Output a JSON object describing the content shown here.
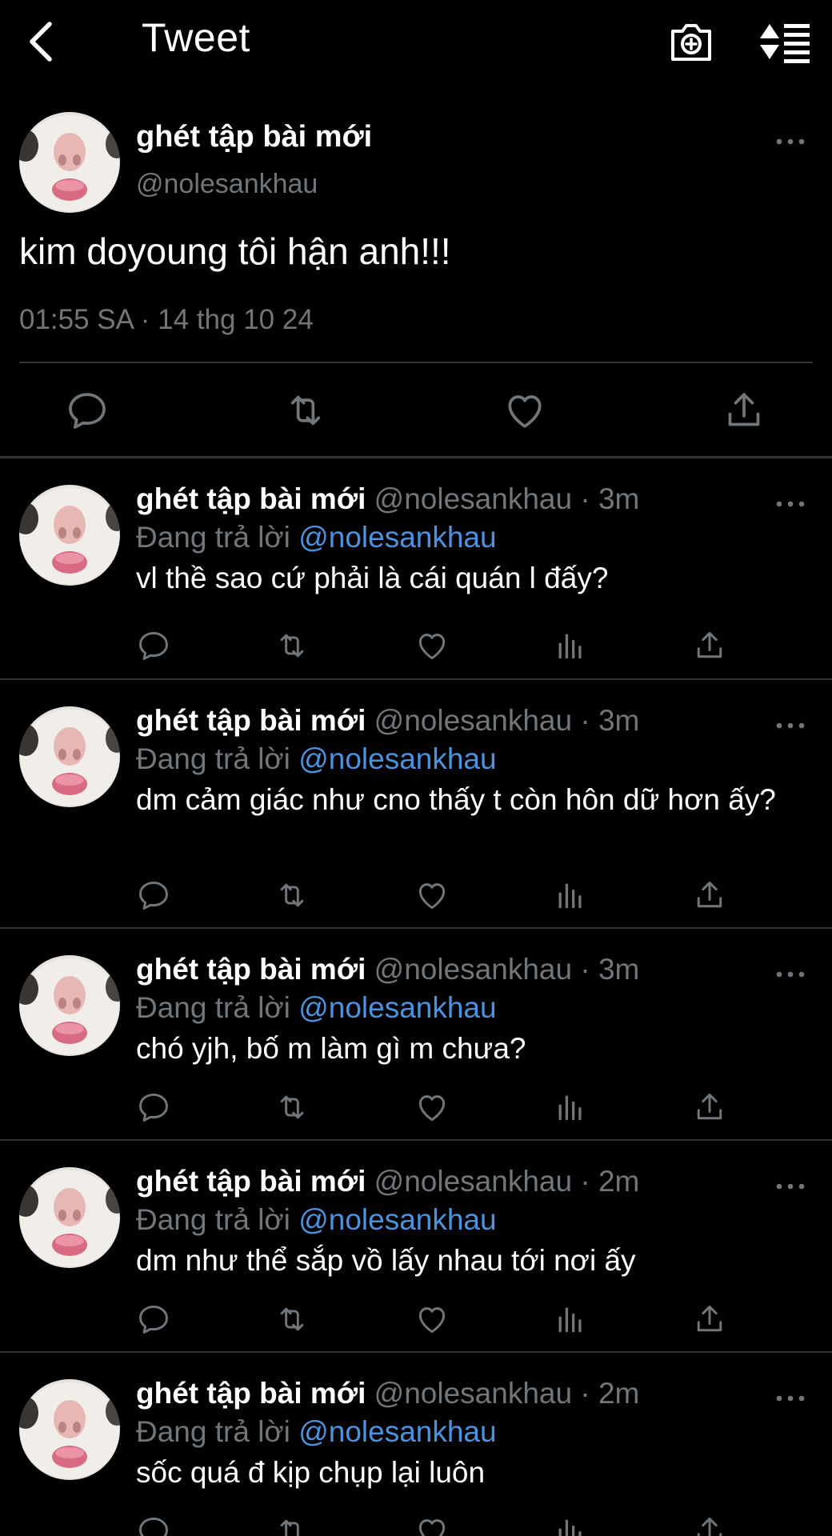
{
  "header": {
    "title": "Tweet"
  },
  "main_tweet": {
    "name": "ghét tập bài mới",
    "handle": "@nolesankhau",
    "text": "kim doyoung tôi hận anh!!!",
    "timestamp": "01:55 SA · 14 thg 10 24"
  },
  "replies": [
    {
      "name": "ghét tập bài mới",
      "meta": "@nolesankhau · 3m",
      "replying_label": "Đang trả lời",
      "mention": "@nolesankhau",
      "text": "vl thề sao cứ phải là cái quán l đấy?"
    },
    {
      "name": "ghét tập bài mới",
      "meta": "@nolesankhau · 3m",
      "replying_label": "Đang trả lời",
      "mention": "@nolesankhau",
      "text": "dm cảm giác như cno thấy t còn hôn dữ hơn ấy?"
    },
    {
      "name": "ghét tập bài mới",
      "meta": "@nolesankhau · 3m",
      "replying_label": "Đang trả lời",
      "mention": "@nolesankhau",
      "text": "chó yjh, bố m làm gì m chưa?"
    },
    {
      "name": "ghét tập bài mới",
      "meta": "@nolesankhau · 2m",
      "replying_label": "Đang trả lời",
      "mention": "@nolesankhau",
      "text": "dm như thể sắp vồ lấy nhau tới nơi ấy"
    },
    {
      "name": "ghét tập bài mới",
      "meta": "@nolesankhau · 2m",
      "replying_label": "Đang trả lời",
      "mention": "@nolesankhau",
      "text": "sốc quá đ kịp chụp lại luôn"
    }
  ],
  "colors": {
    "background": "#000000",
    "text": "#e7e9ea",
    "secondary": "#71767b",
    "link": "#4a93e0",
    "divider": "#2f3336"
  },
  "icons": [
    "back-arrow-icon",
    "camera-add-icon",
    "sort-list-icon",
    "more-dots-icon",
    "reply-icon",
    "retweet-icon",
    "like-icon",
    "views-icon",
    "share-icon"
  ]
}
